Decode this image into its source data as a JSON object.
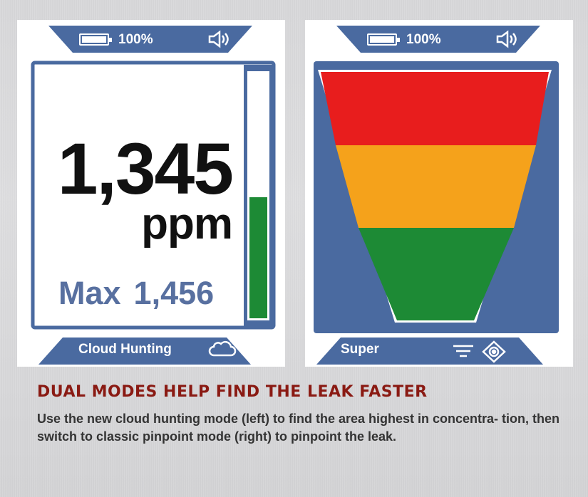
{
  "left_screen": {
    "battery_percent_label": "100%",
    "reading_value": "1,345",
    "reading_unit": "ppm",
    "max_label": "Max",
    "max_value": "1,456",
    "mode_label": "Cloud Hunting",
    "level_fraction": 0.49,
    "icons": [
      "battery-icon",
      "speaker-icon",
      "cloud-icon"
    ]
  },
  "right_screen": {
    "battery_percent_label": "100%",
    "mode_label": "Super",
    "bands": [
      {
        "name": "high",
        "color": "#e81d1d"
      },
      {
        "name": "medium",
        "color": "#f5a21b"
      },
      {
        "name": "low",
        "color": "#1d8a35"
      }
    ],
    "icons": [
      "battery-icon",
      "speaker-icon",
      "filter-icon",
      "pinpoint-icon"
    ]
  },
  "colors": {
    "frame_blue": "#4a6aa0",
    "bar_green": "#1d8a35",
    "title_red": "#8a1a13",
    "max_text": "#5870a0"
  },
  "caption": {
    "title": "DUAL MODES HELP FIND THE LEAK FASTER",
    "body": "Use the new cloud hunting mode (left) to find the area highest in concentra- tion, then switch to classic pinpoint mode (right) to pinpoint the leak."
  }
}
